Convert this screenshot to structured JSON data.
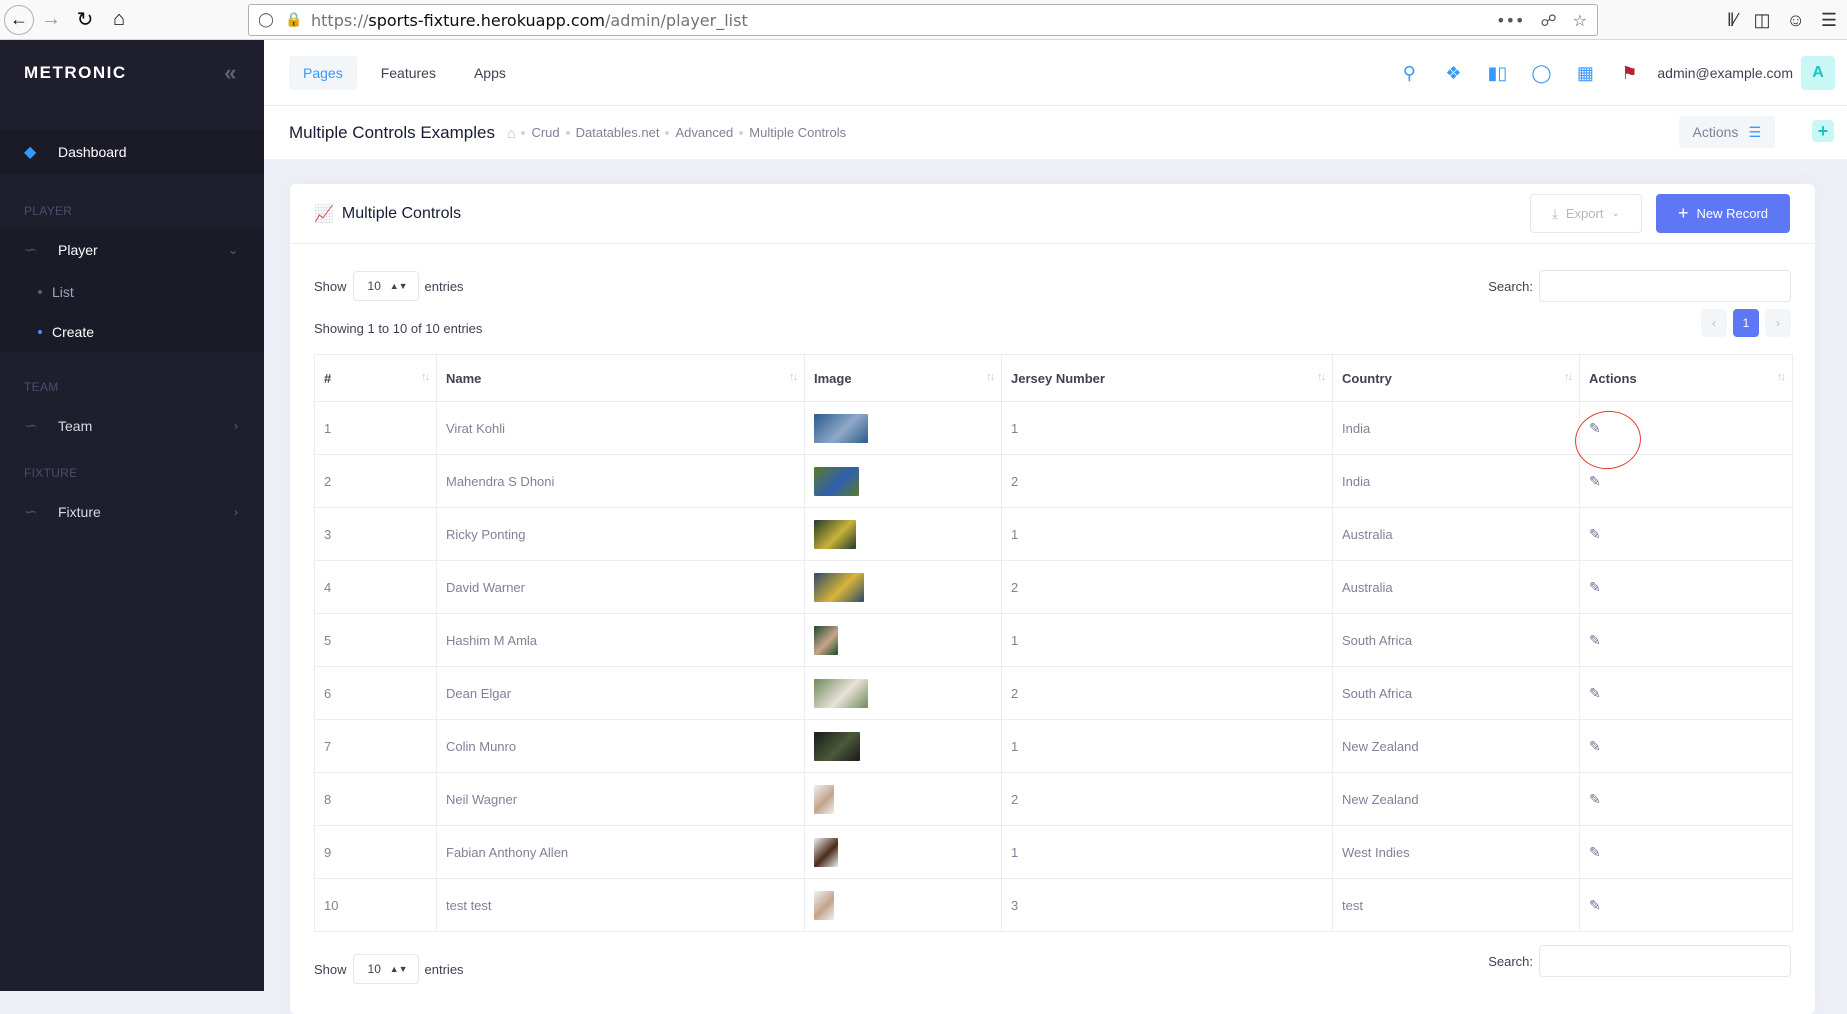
{
  "browser": {
    "url_prefix": "https://",
    "url_host": "sports-fixture.herokuapp.com",
    "url_path": "/admin/player_list"
  },
  "brand": {
    "name": "METRONIC"
  },
  "sidebar": {
    "dashboard": "Dashboard",
    "sections": {
      "player": "PLAYER",
      "team": "TEAM",
      "fixture": "FIXTURE"
    },
    "player": "Player",
    "list": "List",
    "create": "Create",
    "team": "Team",
    "fixture": "Fixture"
  },
  "header": {
    "tabs": [
      "Pages",
      "Features",
      "Apps"
    ],
    "user_email": "admin@example.com",
    "avatar_letter": "A"
  },
  "subheader": {
    "title": "Multiple Controls Examples",
    "breadcrumb": [
      "Crud",
      "Datatables.net",
      "Advanced",
      "Multiple Controls"
    ],
    "actions_label": "Actions",
    "add_label": "+"
  },
  "card": {
    "title": "Multiple Controls",
    "export_label": "Export",
    "new_record_label": "New Record"
  },
  "datatable": {
    "show_label": "Show",
    "entries_label": "entries",
    "page_length": "10",
    "search_label": "Search:",
    "info": "Showing 1 to 10 of 10 entries",
    "current_page": "1",
    "columns": [
      "#",
      "Name",
      "Image",
      "Jersey Number",
      "Country",
      "Actions"
    ],
    "rows": [
      {
        "id": "1",
        "name": "Virat Kohli",
        "jersey": "1",
        "country": "India",
        "img": [
          "#2d5a8a",
          "#8fa8c9"
        ]
      },
      {
        "id": "2",
        "name": "Mahendra S Dhoni",
        "jersey": "2",
        "country": "India",
        "img": [
          "#5a7a2a",
          "#2f5fb0"
        ]
      },
      {
        "id": "3",
        "name": "Ricky Ponting",
        "jersey": "1",
        "country": "Australia",
        "img": [
          "#1d3b2a",
          "#c9b23a"
        ]
      },
      {
        "id": "4",
        "name": "David Warner",
        "jersey": "2",
        "country": "Australia",
        "img": [
          "#2c4a6a",
          "#d8b43a"
        ]
      },
      {
        "id": "5",
        "name": "Hashim M Amla",
        "jersey": "1",
        "country": "South Africa",
        "img": [
          "#1b4a2a",
          "#c7a58c"
        ]
      },
      {
        "id": "6",
        "name": "Dean Elgar",
        "jersey": "2",
        "country": "South Africa",
        "img": [
          "#6e8a5a",
          "#e8e2d8"
        ]
      },
      {
        "id": "7",
        "name": "Colin Munro",
        "jersey": "1",
        "country": "New Zealand",
        "img": [
          "#1a1a1a",
          "#4a5a3a"
        ]
      },
      {
        "id": "8",
        "name": "Neil Wagner",
        "jersey": "2",
        "country": "New Zealand",
        "img": [
          "#f1f1f1",
          "#c4a48a"
        ]
      },
      {
        "id": "9",
        "name": "Fabian Anthony Allen",
        "jersey": "1",
        "country": "West Indies",
        "img": [
          "#f0f0f0",
          "#4a2a1a"
        ]
      },
      {
        "id": "10",
        "name": "test test",
        "jersey": "3",
        "country": "test",
        "img": [
          "#f1f1f1",
          "#c4a48a"
        ]
      }
    ]
  },
  "colors": {
    "primary": "#5e78f5",
    "sidebar_bg": "#1e1e2d",
    "annotation": "#e8382f"
  }
}
